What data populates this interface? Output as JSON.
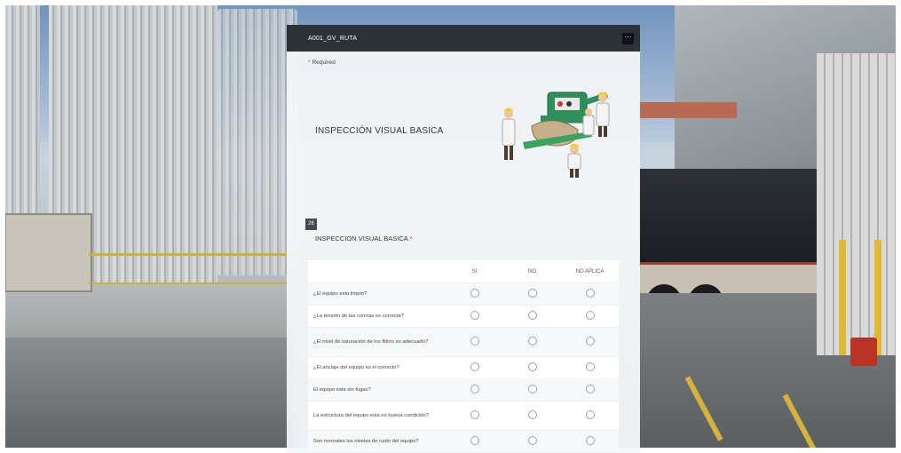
{
  "form": {
    "title": "A001_GV_RUTA",
    "more_label": "···",
    "required_label": "Required",
    "required_mark": "*",
    "banner_title": "INSPECCIÓN VISUAL BASICA",
    "question": {
      "number": "26",
      "title": "INSPECCION VISUAL BASICA",
      "required_mark": "*",
      "columns": [
        "SI",
        "NO",
        "NO APLICA"
      ],
      "rows": [
        {
          "label": "¿El equipo esta limpio?"
        },
        {
          "label": "¿La tensión de las correas es correcta?"
        },
        {
          "label": "¿El nivel de saturación de los filtros es adecuado?"
        },
        {
          "label": "¿El anclaje del equipo es el correcto?"
        },
        {
          "label": "El equipo esta sin fugas?"
        },
        {
          "label": "La estructura del equipo esta en buena condición?"
        },
        {
          "label": "Son normales los niveles de ruido del equipo?"
        }
      ]
    }
  },
  "colors": {
    "header_bg": "#2d3239",
    "required_red": "#c4314b",
    "card_bg": "#f4f6f8"
  },
  "icons": {
    "more": "ellipsis-icon",
    "illustration": "inspection-workers-illustration"
  }
}
